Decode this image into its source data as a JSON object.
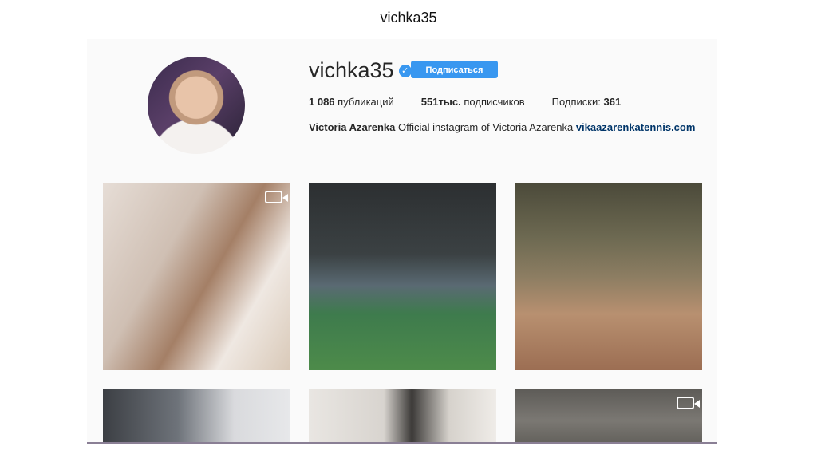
{
  "slide": {
    "title": "vichka35"
  },
  "profile": {
    "username": "vichka35",
    "verified_icon": "verified-check-icon",
    "follow_label": "Подписаться",
    "stats": {
      "posts_count": "1 086",
      "posts_label": "публикаций",
      "followers_count": "551тыс.",
      "followers_label": "подписчиков",
      "following_label": "Подписки:",
      "following_count": "361"
    },
    "bio": {
      "name": "Victoria Azarenka",
      "text": "Official instagram of Victoria Azarenka",
      "link": "vikaazarenkatennis.com"
    }
  },
  "posts": [
    {
      "type": "video",
      "icon": "video-icon"
    },
    {
      "type": "photo"
    },
    {
      "type": "photo"
    },
    {
      "type": "photo"
    },
    {
      "type": "photo"
    },
    {
      "type": "video",
      "icon": "video-icon"
    }
  ],
  "colors": {
    "accent": "#3897f0",
    "link": "#003569"
  }
}
